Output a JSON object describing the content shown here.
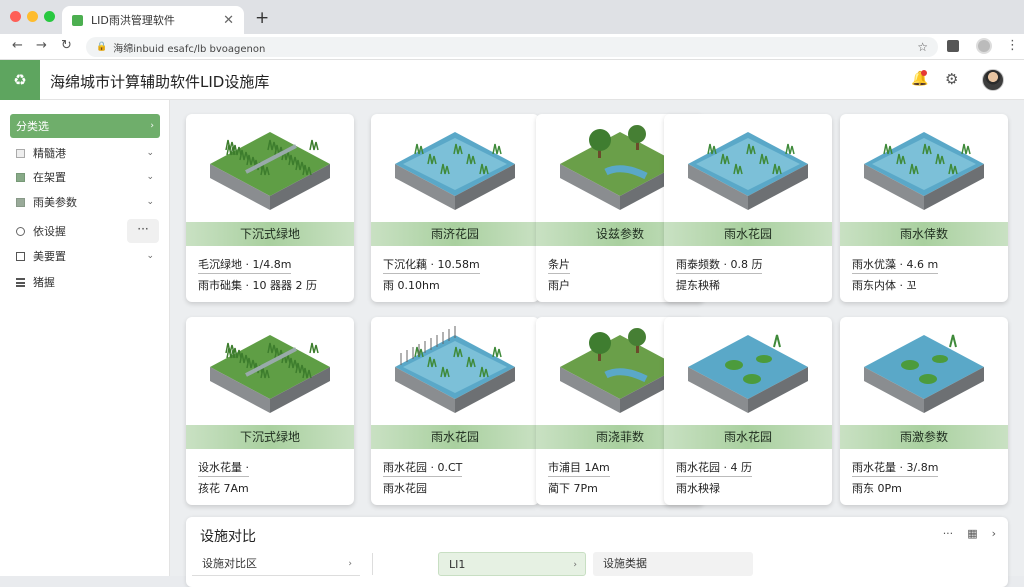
{
  "browser": {
    "tab_title": "LID雨洪管理软件",
    "tab_close": "✕",
    "new_tab": "+",
    "url": "海绵inbuid esafc/lb bvoagenon",
    "back": "←",
    "forward": "→",
    "reload": "↻",
    "lock": "🔒",
    "star": "☆",
    "menu": "⋮"
  },
  "app": {
    "logo": "♻",
    "title": "海绵城市计算辅助软件LID设施库",
    "bell": "🔔",
    "gear": "⚙"
  },
  "sidebar": {
    "items": [
      {
        "label": "分类选",
        "chev": "›"
      },
      {
        "label": "精髓港",
        "chev": "⌄"
      },
      {
        "label": "在架置",
        "chev": "⌄"
      },
      {
        "label": "雨美参数",
        "chev": "⌄"
      },
      {
        "label": "依设握",
        "chev": ""
      },
      {
        "label": "美要置",
        "chev": "⌄"
      },
      {
        "label": "猪握",
        "chev": ""
      }
    ],
    "more": "···"
  },
  "cards": [
    {
      "title": "下沉式绿地",
      "line1": "毛沉绿地 · 1/4.8m",
      "line2": "雨市础集 · 10 器器 2 历"
    },
    {
      "title": "雨济花园",
      "line1": "下沉化藕 · 10.58m",
      "line2": "雨 0.10hm"
    },
    {
      "title": "设兹参数",
      "line1": "条片",
      "line2": "雨户"
    },
    {
      "title": "雨水花园",
      "line1": "雨泰频数 · 0.8 历",
      "line2": "提东秧稀"
    },
    {
      "title": "雨水倖数",
      "line1": "雨水优藻 · 4.6 m",
      "line2": "雨东内体 · 꼬"
    },
    {
      "title": "下沉式绿地",
      "line1": "设水花量 ·",
      "line2": "孩花 7Am"
    },
    {
      "title": "雨水花园",
      "line1": "雨水花园 · 0.CT",
      "line2": "雨水花园"
    },
    {
      "title": "雨浇菲数",
      "line1": "市浦目 1Am",
      "line2": "蔺下 7Pm"
    },
    {
      "title": "雨水花园",
      "line1": "雨水花园 · 4 历",
      "line2": "雨水秧禄"
    },
    {
      "title": "雨激参数",
      "line1": "雨水花量 · 3/.8m",
      "line2": "雨东 0Pm"
    }
  ],
  "compare": {
    "title": "设施对比",
    "tools": [
      "···",
      "▦",
      "›"
    ],
    "selects": [
      {
        "label": "设施对比区",
        "chev": "›"
      },
      {
        "label": "LI1",
        "chev": "›"
      },
      {
        "label": "设施类据",
        "chev": ""
      }
    ]
  },
  "colors": {
    "accent": "#6fae6b",
    "band": "#a9d09f",
    "logo": "#5ea55f",
    "water": "#5aa8c8"
  }
}
